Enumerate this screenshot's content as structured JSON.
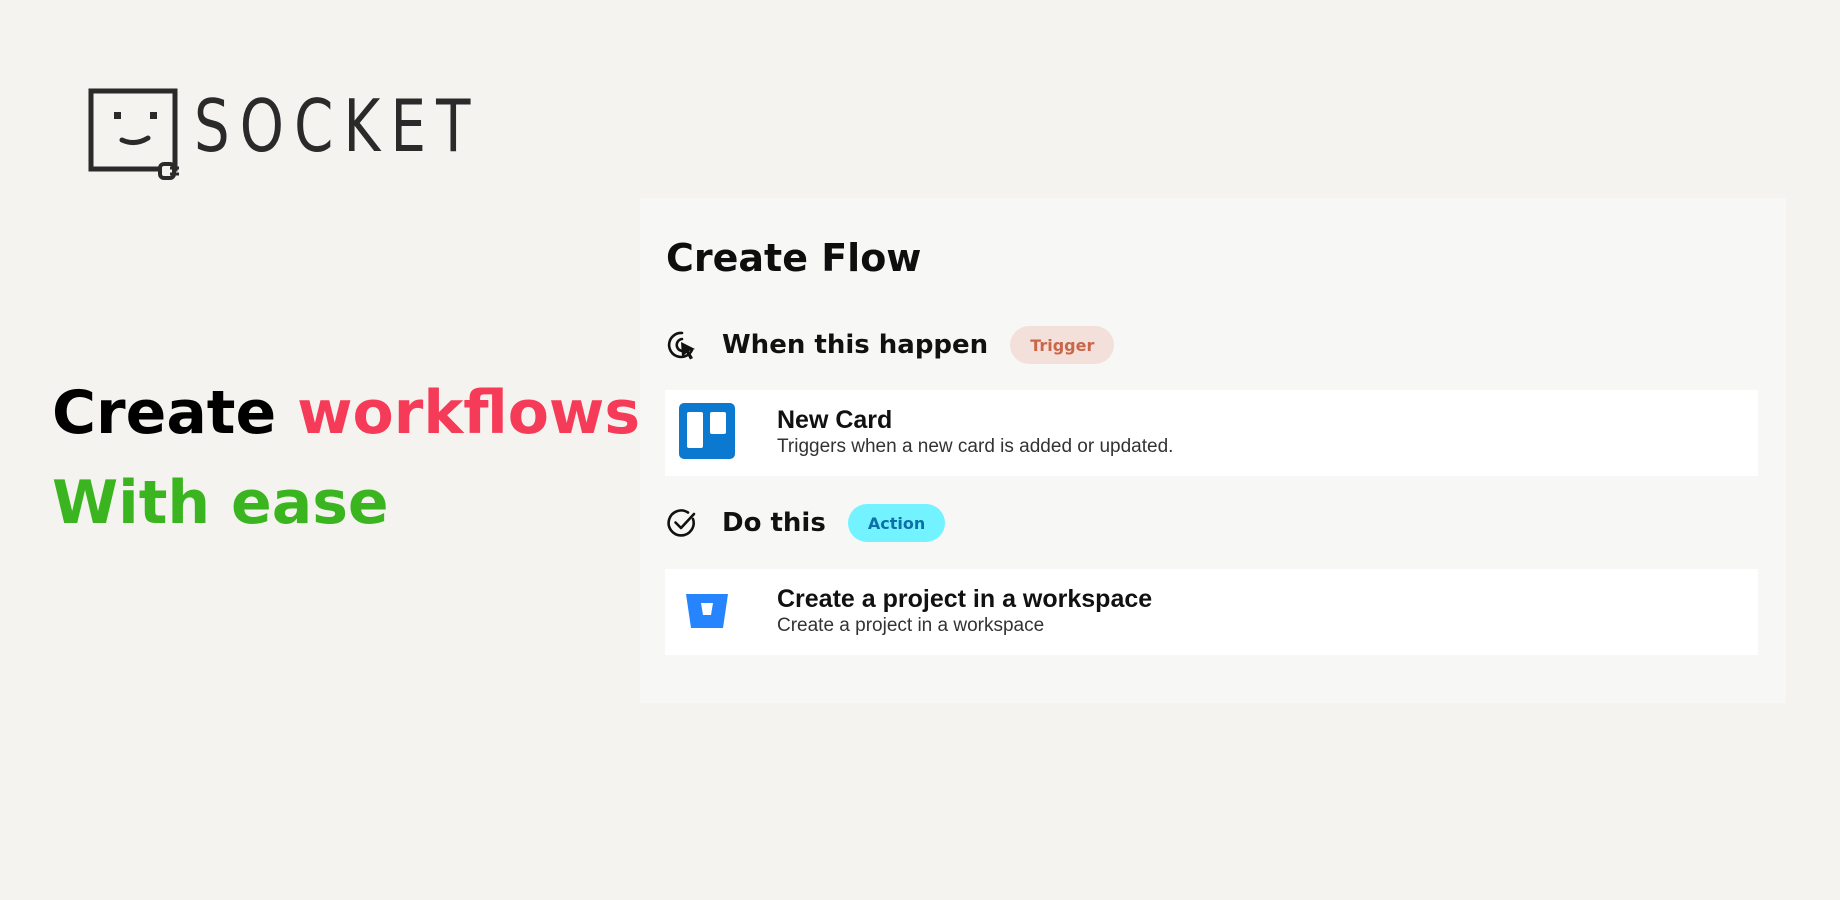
{
  "brand": {
    "name": "SOCKET"
  },
  "headline": {
    "line1_plain": "Create",
    "line1_accent": "workflows",
    "line2": "With ease",
    "colors": {
      "primary": "#000000",
      "accent": "#f53b57",
      "secondary": "#3bb51f"
    }
  },
  "flow": {
    "title": "Create Flow",
    "trigger_section": {
      "icon": "pointer-click-icon",
      "label": "When this happen",
      "badge": "Trigger"
    },
    "trigger_item": {
      "icon": "trello-icon",
      "title": "New Card",
      "description": "Triggers when a new card is added or updated."
    },
    "action_section": {
      "icon": "check-circle-icon",
      "label": "Do this",
      "badge": "Action"
    },
    "action_item": {
      "icon": "bitbucket-icon",
      "title": "Create a project in a workspace",
      "description": "Create a project in a workspace"
    }
  }
}
